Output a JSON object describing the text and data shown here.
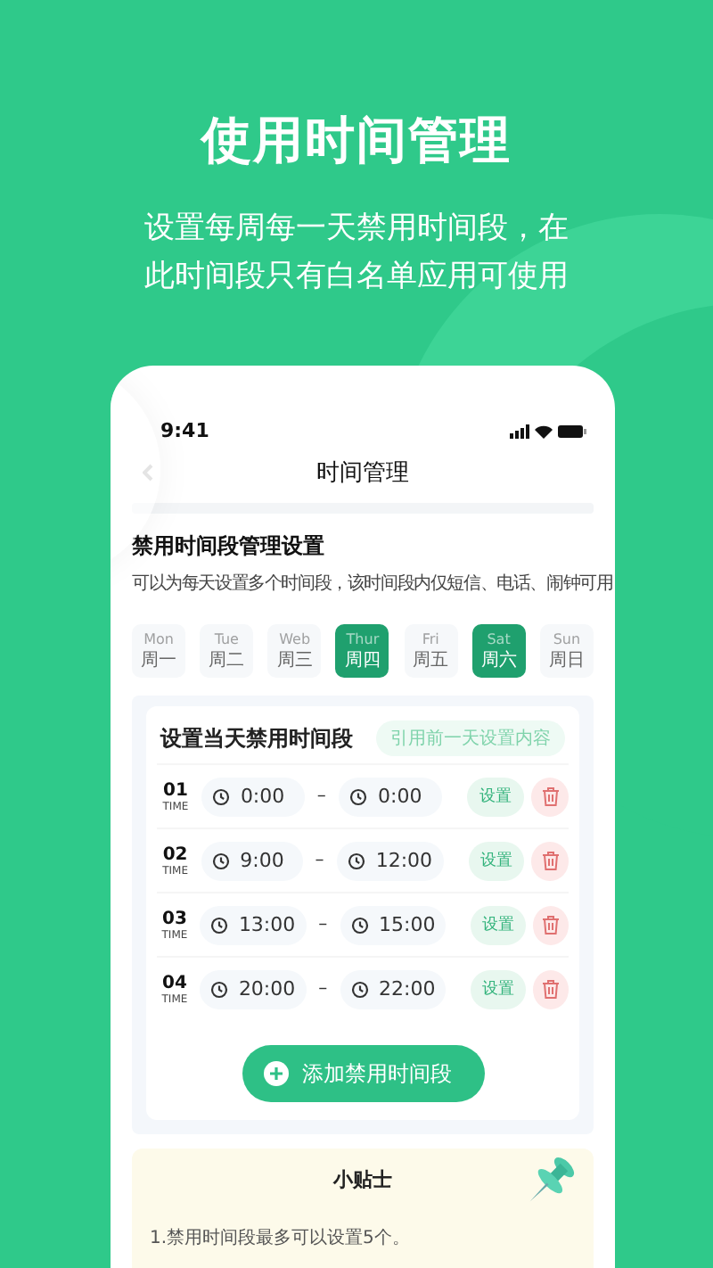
{
  "headline": "使用时间管理",
  "subtitle_lines": [
    "设置每周每一天禁用时间段，在",
    "此时间段只有白名单应用可使用"
  ],
  "phone": {
    "status_time": "9:41",
    "title": "时间管理",
    "section_title": "禁用时间段管理设置",
    "section_desc": "可以为每天设置多个时间段，该时间段内仅短信、电话、闹钟可用",
    "days": [
      {
        "en": "Mon",
        "cn": "周一",
        "selected": false
      },
      {
        "en": "Tue",
        "cn": "周二",
        "selected": false
      },
      {
        "en": "Web",
        "cn": "周三",
        "selected": false
      },
      {
        "en": "Thur",
        "cn": "周四",
        "selected": true
      },
      {
        "en": "Fri",
        "cn": "周五",
        "selected": false
      },
      {
        "en": "Sat",
        "cn": "周六",
        "selected": true
      },
      {
        "en": "Sun",
        "cn": "周日",
        "selected": false
      }
    ],
    "card_title": "设置当天禁用时间段",
    "copy_button": "引用前一天设置内容",
    "slots": [
      {
        "index": "01",
        "label": "TIME",
        "start": "0:00",
        "end": "0:00",
        "set_label": "设置"
      },
      {
        "index": "02",
        "label": "TIME",
        "start": "9:00",
        "end": "12:00",
        "set_label": "设置"
      },
      {
        "index": "03",
        "label": "TIME",
        "start": "13:00",
        "end": "15:00",
        "set_label": "设置"
      },
      {
        "index": "04",
        "label": "TIME",
        "start": "20:00",
        "end": "22:00",
        "set_label": "设置"
      }
    ],
    "separator": "–",
    "add_button": "添加禁用时间段",
    "tips": {
      "title": "小贴士",
      "lines": [
        "1.禁用时间段最多可以设置5个。"
      ]
    }
  }
}
